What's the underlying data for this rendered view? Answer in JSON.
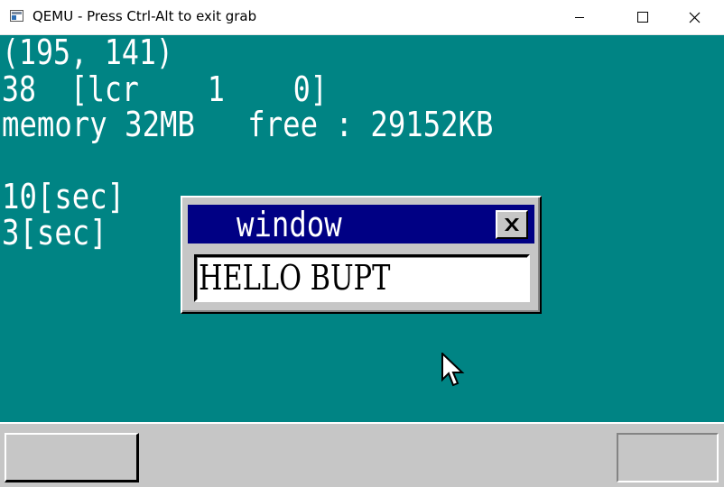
{
  "host_window": {
    "title": "QEMU - Press Ctrl-Alt to exit grab",
    "icon": "qemu-app-icon",
    "controls": [
      "minimize-icon",
      "maximize-icon",
      "close-icon"
    ]
  },
  "screen": {
    "background_color": "#008484",
    "lines": {
      "mouse_coords": "(195, 141)",
      "key_line": "38  [lcr    1    0]",
      "memory_line": "memory 32MB   free : 29152KB",
      "timer1": "10[sec]",
      "timer2": "3[sec]"
    }
  },
  "inner_window": {
    "title": "window",
    "textbox_value": "HELLO BUPT",
    "title_color": "#000084",
    "close_icon": "close-x-icon"
  },
  "cursor": {
    "icon": "arrow-cursor-icon"
  },
  "taskbar": {
    "color": "#c6c6c6"
  }
}
